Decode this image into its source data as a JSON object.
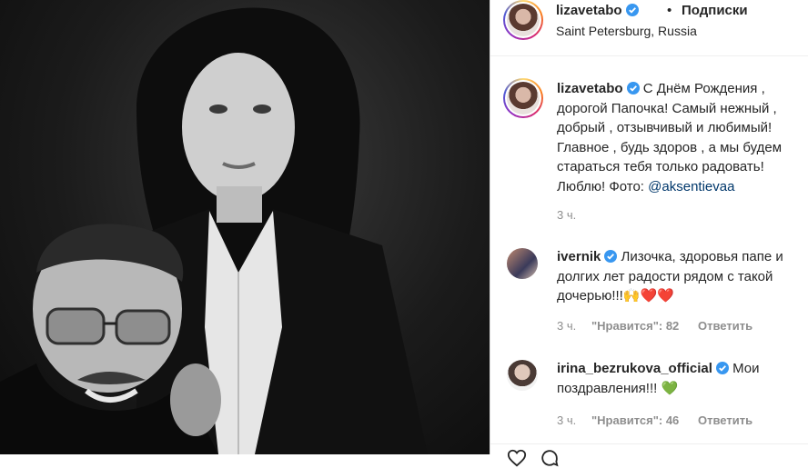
{
  "post": {
    "username": "lizavetabo",
    "dot": "•",
    "follow_label": "Подписки",
    "location": "Saint Petersburg, Russia"
  },
  "caption": {
    "username": "lizavetabo",
    "text_before": "С Днём Рождения , дорогой Папочка! Самый нежный , добрый , отзывчивый и любимый! Главное , будь здоров , а мы будем стараться тебя только радовать! Люблю! Фото: ",
    "mention": "@aksentievaa",
    "time": "3 ч."
  },
  "comments": [
    {
      "username": "ivernik",
      "text": "Лизочка, здоровья папе и долгих лет радости рядом с такой дочерью!!!🙌❤️❤️",
      "time": "3 ч.",
      "likes": "\"Нравится\": 82",
      "reply": "Ответить"
    },
    {
      "username": "irina_bezrukova_official",
      "text": "Мои поздравления!!! 💚",
      "time": "3 ч.",
      "likes": "\"Нравится\": 46",
      "reply": "Ответить"
    }
  ],
  "colors": {
    "verified": "#3897f0",
    "text": "#262626",
    "muted": "#8e8e8e",
    "link": "#00376b"
  },
  "icons": [
    "verified-badge-icon",
    "heart-icon",
    "comment-icon"
  ]
}
